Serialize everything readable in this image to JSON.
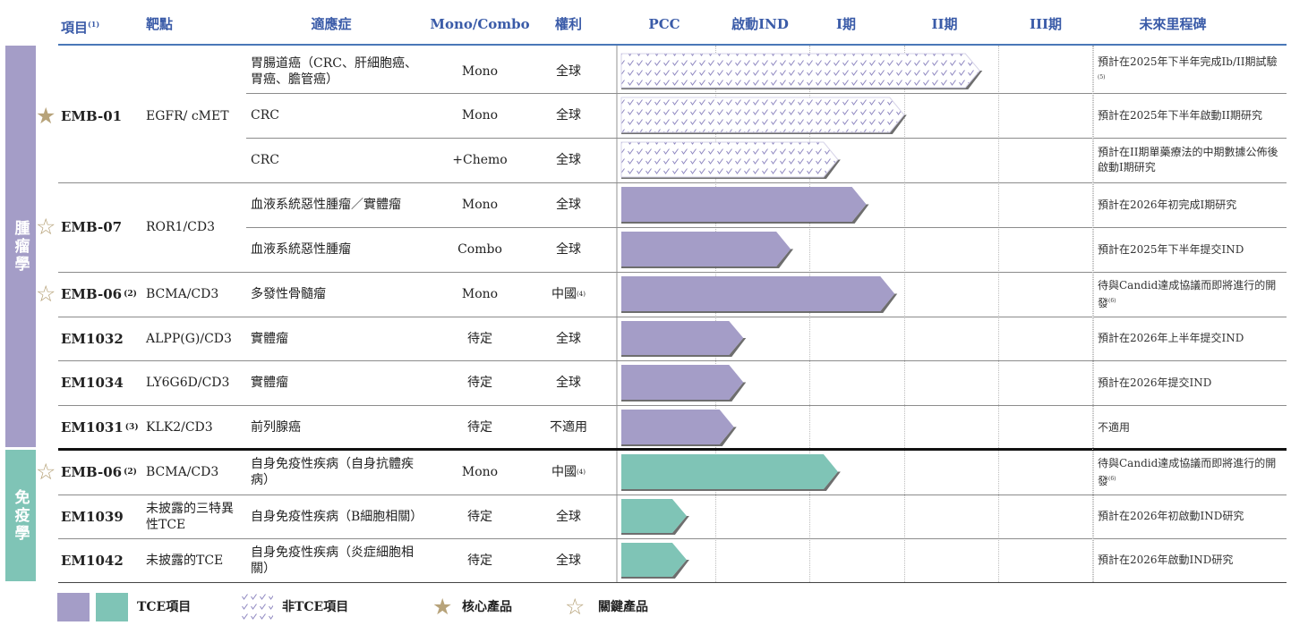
{
  "headers": {
    "project": "項目",
    "project_note": "(1)",
    "target": "靶點",
    "indication": "適應症",
    "mono_combo": "Mono/Combo",
    "rights": "權利",
    "milestones": "未來里程碑"
  },
  "groups": {
    "oncology": "腫瘤學",
    "immunology": "免疫學"
  },
  "colors": {
    "oncology_bar": "#a49dc7",
    "immunology_bar": "#7fc4b6",
    "non_tce_pattern": "#8d86c0",
    "star": "#b7a37a",
    "header_text": "#3a5ba8"
  },
  "projects": [
    {
      "name": "EMB-01",
      "note": "",
      "star": "core",
      "target": "EGFR/ cMET"
    },
    {
      "name": "EMB-07",
      "note": "",
      "star": "key",
      "target": "ROR1/CD3"
    },
    {
      "name": "EMB-06",
      "note": "(2)",
      "star": "key",
      "target": "BCMA/CD3"
    },
    {
      "name": "EM1032",
      "note": "",
      "star": "",
      "target": "ALPP(G)/CD3"
    },
    {
      "name": "EM1034",
      "note": "",
      "star": "",
      "target": "LY6G6D/CD3"
    },
    {
      "name": "EM1031",
      "note": "(3)",
      "star": "",
      "target": "KLK2/CD3"
    },
    {
      "name": "EMB-06",
      "note": "(2)",
      "star": "key",
      "target": "BCMA/CD3"
    },
    {
      "name": "EM1039",
      "note": "",
      "star": "",
      "target": "未披露的三特異性TCE"
    },
    {
      "name": "EM1042",
      "note": "",
      "star": "",
      "target": "未披露的TCE"
    }
  ],
  "rows": [
    {
      "indication": "胃腸道癌（CRC、肝細胞癌、胃癌、膽管癌）",
      "mono": "Mono",
      "rights": "全球",
      "rights_note": "",
      "milestone": "預計在2025年下半年完成Ib/II期試驗",
      "milestone_note": "(5)"
    },
    {
      "indication": "CRC",
      "mono": "Mono",
      "rights": "全球",
      "rights_note": "",
      "milestone": "預計在2025年下半年啟動II期研究",
      "milestone_note": ""
    },
    {
      "indication": "CRC",
      "mono": "+Chemo",
      "rights": "全球",
      "rights_note": "",
      "milestone": "預計在II期單藥療法的中期數據公佈後啟動I期研究",
      "milestone_note": ""
    },
    {
      "indication": "血液系統惡性腫瘤／實體瘤",
      "mono": "Mono",
      "rights": "全球",
      "rights_note": "",
      "milestone": "預計在2026年初完成I期研究",
      "milestone_note": ""
    },
    {
      "indication": "血液系統惡性腫瘤",
      "mono": "Combo",
      "rights": "全球",
      "rights_note": "",
      "milestone": "預計在2025年下半年提交IND",
      "milestone_note": ""
    },
    {
      "indication": "多發性骨髓瘤",
      "mono": "Mono",
      "rights": "中國",
      "rights_note": "(4)",
      "milestone": "待與Candid達成協議而即將進行的開發",
      "milestone_note": "(6)"
    },
    {
      "indication": "實體瘤",
      "mono": "待定",
      "rights": "全球",
      "rights_note": "",
      "milestone": "預計在2026年上半年提交IND",
      "milestone_note": ""
    },
    {
      "indication": "實體瘤",
      "mono": "待定",
      "rights": "全球",
      "rights_note": "",
      "milestone": "預計在2026年提交IND",
      "milestone_note": ""
    },
    {
      "indication": "前列腺癌",
      "mono": "待定",
      "rights": "不適用",
      "rights_note": "",
      "milestone": "不適用",
      "milestone_note": ""
    },
    {
      "indication": "自身免疫性疾病（自身抗體疾病）",
      "mono": "Mono",
      "rights": "中國",
      "rights_note": "(4)",
      "milestone": "待與Candid達成協議而即將進行的開發",
      "milestone_note": "(6)"
    },
    {
      "indication": "自身免疫性疾病（B細胞相關）",
      "mono": "待定",
      "rights": "全球",
      "rights_note": "",
      "milestone": "預計在2026年初啟動IND研究",
      "milestone_note": ""
    },
    {
      "indication": "自身免疫性疾病（炎症細胞相關）",
      "mono": "待定",
      "rights": "全球",
      "rights_note": "",
      "milestone": "預計在2026年啟動IND研究",
      "milestone_note": ""
    }
  ],
  "chart_data": {
    "type": "bar",
    "orientation": "horizontal",
    "title": "",
    "categories": [
      "PCC",
      "啟動IND",
      "I期",
      "II期",
      "III期"
    ],
    "unit": "development stages reached",
    "series": [
      {
        "name": "非TCE項目",
        "values": [
          3.8,
          3.0,
          2.3,
          null,
          null,
          null,
          null,
          null,
          null,
          null,
          null,
          null
        ]
      },
      {
        "name": "TCE項目",
        "values": [
          null,
          null,
          null,
          2.6,
          1.8,
          2.9,
          1.3,
          1.3,
          1.2,
          2.3,
          0.7,
          0.7
        ]
      }
    ],
    "bars": [
      {
        "row": 0,
        "value": 3.8,
        "kind": "non_tce",
        "group": "oncology"
      },
      {
        "row": 1,
        "value": 3.0,
        "kind": "non_tce",
        "group": "oncology"
      },
      {
        "row": 2,
        "value": 2.3,
        "kind": "non_tce",
        "group": "oncology"
      },
      {
        "row": 3,
        "value": 2.6,
        "kind": "tce",
        "group": "oncology"
      },
      {
        "row": 4,
        "value": 1.8,
        "kind": "tce",
        "group": "oncology"
      },
      {
        "row": 5,
        "value": 2.9,
        "kind": "tce",
        "group": "oncology"
      },
      {
        "row": 6,
        "value": 1.3,
        "kind": "tce",
        "group": "oncology"
      },
      {
        "row": 7,
        "value": 1.3,
        "kind": "tce",
        "group": "oncology"
      },
      {
        "row": 8,
        "value": 1.2,
        "kind": "tce",
        "group": "oncology"
      },
      {
        "row": 9,
        "value": 2.3,
        "kind": "tce",
        "group": "immunology"
      },
      {
        "row": 10,
        "value": 0.7,
        "kind": "tce",
        "group": "immunology"
      },
      {
        "row": 11,
        "value": 0.7,
        "kind": "tce",
        "group": "immunology"
      }
    ],
    "xlim": [
      0,
      5
    ]
  },
  "legend": {
    "tce": "TCE項目",
    "non_tce": "非TCE項目",
    "core": "核心產品",
    "key": "關鍵產品"
  }
}
